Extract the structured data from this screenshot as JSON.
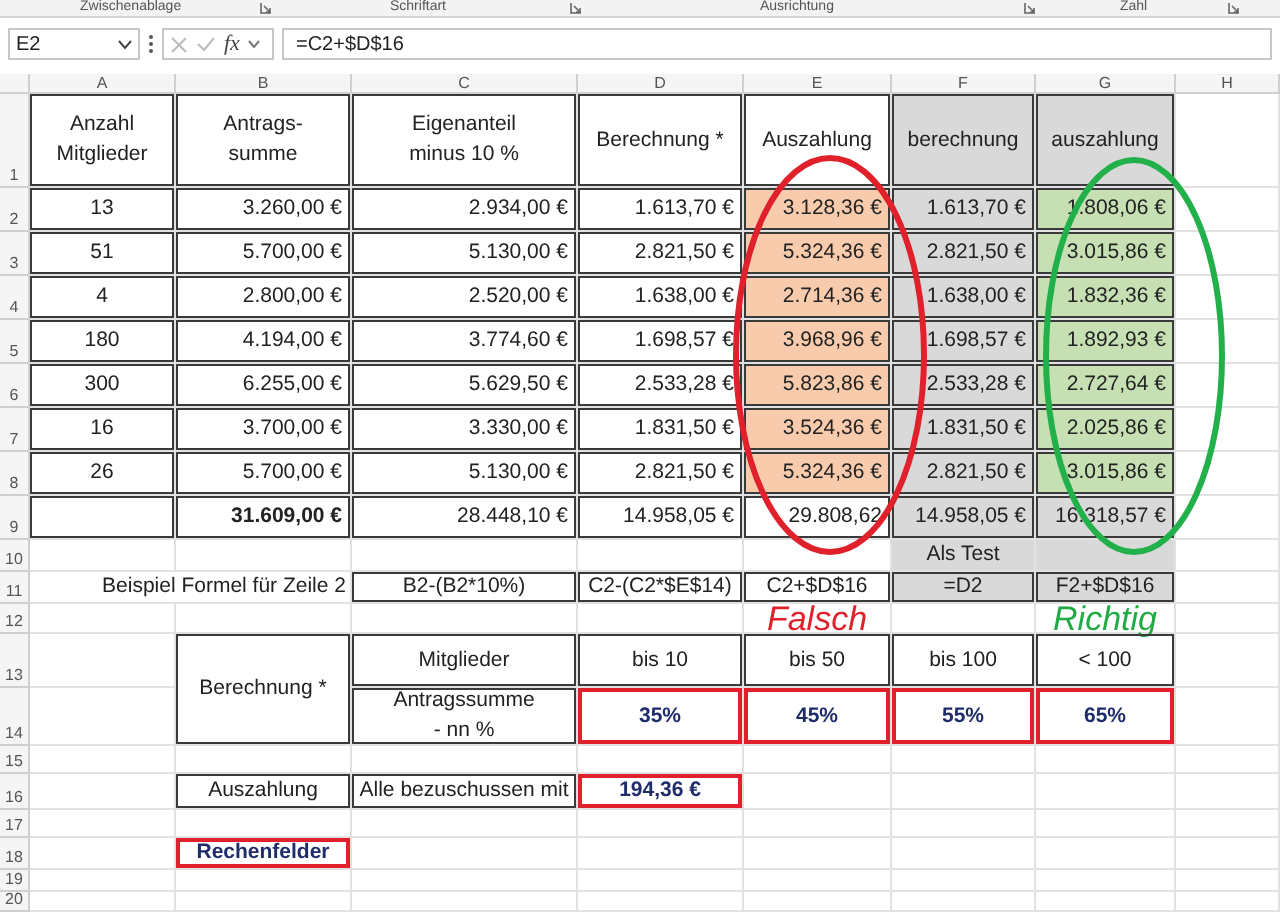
{
  "ribbon_groups": [
    "Zwischenablage",
    "Schriftart",
    "Ausrichtung",
    "Zahl"
  ],
  "formula_bar": {
    "name_box": "E2",
    "fx": "fx",
    "formula": "=C2+$D$16"
  },
  "columns": [
    "A",
    "B",
    "C",
    "D",
    "E",
    "F",
    "G",
    "H"
  ],
  "rows": [
    {
      "number": "1",
      "cells": {
        "A": {
          "text": "Anzahl\nMitglieder",
          "border": true
        },
        "B": {
          "text": "Antrags-\nsumme",
          "border": true
        },
        "C": {
          "text": "Eigenanteil\nminus 10 %",
          "border": true
        },
        "D": {
          "text": "Berechnung *",
          "border": true
        },
        "E": {
          "text": "Auszahlung",
          "border": true
        },
        "F": {
          "text": "berechnung",
          "border": true,
          "color": "#d9d9d9"
        },
        "G": {
          "text": "auszahlung",
          "border": true,
          "color": "#d9d9d9"
        }
      }
    },
    {
      "number": "2",
      "cells": {
        "A": {
          "text": "13",
          "border": true
        },
        "B": {
          "text": "3.260,00 €",
          "border": true
        },
        "C": {
          "text": "2.934,00 €",
          "border": true
        },
        "D": {
          "text": "1.613,70 €",
          "border": true
        },
        "E": {
          "text": "3.128,36 €",
          "border": true,
          "color": "#f8cbad"
        },
        "F": {
          "text": "1.613,70 €",
          "border": true,
          "color": "#d9d9d9"
        },
        "G": {
          "text": "1.808,06 €",
          "border": true,
          "color": "#c6e0b4"
        }
      }
    },
    {
      "number": "3",
      "cells": {
        "A": {
          "text": "51",
          "border": true
        },
        "B": {
          "text": "5.700,00 €",
          "border": true
        },
        "C": {
          "text": "5.130,00 €",
          "border": true
        },
        "D": {
          "text": "2.821,50 €",
          "border": true
        },
        "E": {
          "text": "5.324,36 €",
          "border": true,
          "color": "#f8cbad"
        },
        "F": {
          "text": "2.821,50 €",
          "border": true,
          "color": "#d9d9d9"
        },
        "G": {
          "text": "3.015,86 €",
          "border": true,
          "color": "#c6e0b4"
        }
      }
    },
    {
      "number": "4",
      "cells": {
        "A": {
          "text": "4",
          "border": true
        },
        "B": {
          "text": "2.800,00 €",
          "border": true
        },
        "C": {
          "text": "2.520,00 €",
          "border": true
        },
        "D": {
          "text": "1.638,00 €",
          "border": true
        },
        "E": {
          "text": "2.714,36 €",
          "border": true,
          "color": "#f8cbad"
        },
        "F": {
          "text": "1.638,00 €",
          "border": true,
          "color": "#d9d9d9"
        },
        "G": {
          "text": "1.832,36 €",
          "border": true,
          "color": "#c6e0b4"
        }
      }
    },
    {
      "number": "5",
      "cells": {
        "A": {
          "text": "180",
          "border": true
        },
        "B": {
          "text": "4.194,00 €",
          "border": true
        },
        "C": {
          "text": "3.774,60 €",
          "border": true
        },
        "D": {
          "text": "1.698,57 €",
          "border": true
        },
        "E": {
          "text": "3.968,96 €",
          "border": true,
          "color": "#f8cbad"
        },
        "F": {
          "text": "1.698,57 €",
          "border": true,
          "color": "#d9d9d9"
        },
        "G": {
          "text": "1.892,93 €",
          "border": true,
          "color": "#c6e0b4"
        }
      }
    },
    {
      "number": "6",
      "cells": {
        "A": {
          "text": "300",
          "border": true
        },
        "B": {
          "text": "6.255,00 €",
          "border": true
        },
        "C": {
          "text": "5.629,50 €",
          "border": true
        },
        "D": {
          "text": "2.533,28 €",
          "border": true
        },
        "E": {
          "text": "5.823,86 €",
          "border": true,
          "color": "#f8cbad"
        },
        "F": {
          "text": "2.533,28 €",
          "border": true,
          "color": "#d9d9d9"
        },
        "G": {
          "text": "2.727,64 €",
          "border": true,
          "color": "#c6e0b4"
        }
      }
    },
    {
      "number": "7",
      "cells": {
        "A": {
          "text": "16",
          "border": true
        },
        "B": {
          "text": "3.700,00 €",
          "border": true
        },
        "C": {
          "text": "3.330,00 €",
          "border": true
        },
        "D": {
          "text": "1.831,50 €",
          "border": true
        },
        "E": {
          "text": "3.524,36 €",
          "border": true,
          "color": "#f8cbad"
        },
        "F": {
          "text": "1.831,50 €",
          "border": true,
          "color": "#d9d9d9"
        },
        "G": {
          "text": "2.025,86 €",
          "border": true,
          "color": "#c6e0b4"
        }
      }
    },
    {
      "number": "8",
      "cells": {
        "A": {
          "text": "26",
          "border": true
        },
        "B": {
          "text": "5.700,00 €",
          "border": true
        },
        "C": {
          "text": "5.130,00 €",
          "border": true
        },
        "D": {
          "text": "2.821,50 €",
          "border": true
        },
        "E": {
          "text": "5.324,36 €",
          "border": true,
          "color": "#f8cbad"
        },
        "F": {
          "text": "2.821,50 €",
          "border": true,
          "color": "#d9d9d9"
        },
        "G": {
          "text": "3.015,86 €",
          "border": true,
          "color": "#c6e0b4"
        }
      }
    },
    {
      "number": "9",
      "cells": {
        "A": {
          "border": true
        },
        "B": {
          "text": "31.609,00 €",
          "border": true,
          "bold": true
        },
        "C": {
          "text": "28.448,10 €",
          "border": true
        },
        "D": {
          "text": "14.958,05 €",
          "border": true
        },
        "E": {
          "text": "29.808,62",
          "border": true
        },
        "F": {
          "text": "14.958,05 €",
          "border": true,
          "color": "#d9d9d9"
        },
        "G": {
          "text": "16.318,57 €",
          "border": true,
          "color": "#d9d9d9"
        }
      }
    },
    {
      "number": "10",
      "cells": {
        "F": {
          "text": "Als Test",
          "color": "#d9d9d9"
        },
        "G": {
          "color": "#d9d9d9"
        }
      }
    },
    {
      "number": "11",
      "cells": {
        "B": {
          "text": "Beispiel Formel für Zeile 2"
        },
        "C": {
          "text": "B2-(B2*10%)",
          "border": true
        },
        "D": {
          "text": "C2-(C2*$E$14)",
          "border": true
        },
        "E": {
          "text": "C2+$D$16",
          "border": true
        },
        "F": {
          "text": "=D2",
          "border": true,
          "color": "#d9d9d9"
        },
        "G": {
          "text": "F2+$D$16",
          "border": true,
          "color": "#d9d9d9"
        }
      }
    },
    {
      "number": "12",
      "cells": {
        "E": {
          "text": "Falsch",
          "note": true,
          "color": "#e0202a"
        },
        "G": {
          "text": "Richtig",
          "note": true,
          "color": "#22aa44"
        }
      }
    },
    {
      "number": "13",
      "cells": {
        "B": {
          "text": "Berechnung *",
          "border": true,
          "merged_with_next_row": true
        },
        "C": {
          "text": "Mitglieder",
          "border": true
        },
        "D": {
          "text": "bis 10",
          "border": true
        },
        "E": {
          "text": "bis 50",
          "border": true
        },
        "F": {
          "text": "bis 100",
          "border": true
        },
        "G": {
          "text": "< 100",
          "border": true
        }
      }
    },
    {
      "number": "14",
      "cells": {
        "C": {
          "text": "Antragssumme\n- nn %",
          "border": true
        },
        "D": {
          "text": "35%",
          "calc_field": true
        },
        "E": {
          "text": "45%",
          "calc_field": true
        },
        "F": {
          "text": "55%",
          "calc_field": true
        },
        "G": {
          "text": "65%",
          "calc_field": true
        }
      }
    },
    {
      "number": "15",
      "cells": {}
    },
    {
      "number": "16",
      "cells": {
        "B": {
          "text": "Auszahlung",
          "border": true
        },
        "C": {
          "text": "Alle bezuschussen mit",
          "border": true
        },
        "D": {
          "text": "194,36 €",
          "calc_field": true
        }
      }
    },
    {
      "number": "17",
      "cells": {}
    },
    {
      "number": "18",
      "cells": {
        "B": {
          "text": "Rechenfelder",
          "calc_field": true
        }
      }
    },
    {
      "number": "19",
      "cells": {}
    },
    {
      "number": "20",
      "cells": {}
    }
  ],
  "annotations": [
    {
      "kind": "oval",
      "color": "#e0202a"
    },
    {
      "kind": "oval",
      "color": "#22b04a"
    }
  ]
}
